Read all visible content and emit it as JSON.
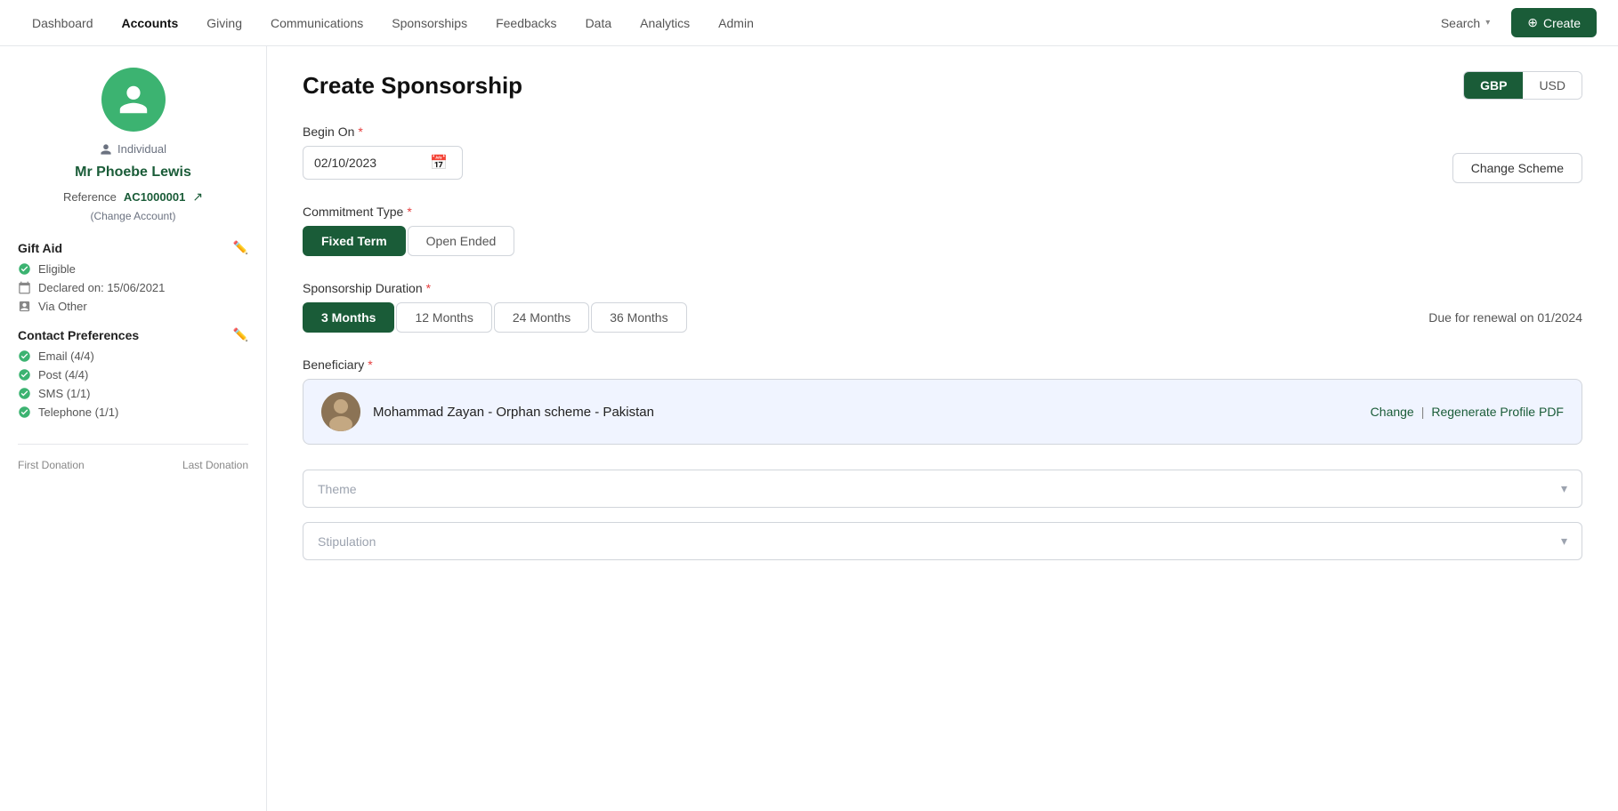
{
  "nav": {
    "items": [
      {
        "label": "Dashboard",
        "active": false
      },
      {
        "label": "Accounts",
        "active": true
      },
      {
        "label": "Giving",
        "active": false
      },
      {
        "label": "Communications",
        "active": false
      },
      {
        "label": "Sponsorships",
        "active": false
      },
      {
        "label": "Feedbacks",
        "active": false
      },
      {
        "label": "Data",
        "active": false
      },
      {
        "label": "Analytics",
        "active": false
      },
      {
        "label": "Admin",
        "active": false
      }
    ],
    "search_label": "Search",
    "create_label": "Create"
  },
  "sidebar": {
    "individual_label": "Individual",
    "person_name": "Mr Phoebe Lewis",
    "reference_label": "Reference",
    "reference_id": "AC1000001",
    "change_account_label": "(Change Account)",
    "gift_aid_title": "Gift Aid",
    "eligible_label": "Eligible",
    "declared_label": "Declared on: 15/06/2021",
    "via_label": "Via Other",
    "contact_prefs_title": "Contact Preferences",
    "email_label": "Email (4/4)",
    "post_label": "Post (4/4)",
    "sms_label": "SMS (1/1)",
    "telephone_label": "Telephone (1/1)",
    "first_donation_label": "First Donation",
    "last_donation_label": "Last Donation"
  },
  "form": {
    "title": "Create Sponsorship",
    "currency_gbp": "GBP",
    "currency_usd": "USD",
    "currency_active": "GBP",
    "change_scheme_label": "Change Scheme",
    "begin_on_label": "Begin On",
    "begin_on_value": "02/10/2023",
    "commitment_type_label": "Commitment Type",
    "commitment_types": [
      {
        "label": "Fixed Term",
        "active": true
      },
      {
        "label": "Open Ended",
        "active": false
      }
    ],
    "duration_label": "Sponsorship Duration",
    "duration_options": [
      {
        "label": "3 Months",
        "active": true
      },
      {
        "label": "12 Months",
        "active": false
      },
      {
        "label": "24 Months",
        "active": false
      },
      {
        "label": "36 Months",
        "active": false
      }
    ],
    "renewal_text": "Due for renewal on 01/2024",
    "beneficiary_label": "Beneficiary",
    "beneficiary_name": "Mohammad Zayan - Orphan scheme - Pakistan",
    "beneficiary_change_label": "Change",
    "beneficiary_regenerate_label": "Regenerate Profile PDF",
    "theme_placeholder": "Theme",
    "stipulation_placeholder": "Stipulation"
  }
}
